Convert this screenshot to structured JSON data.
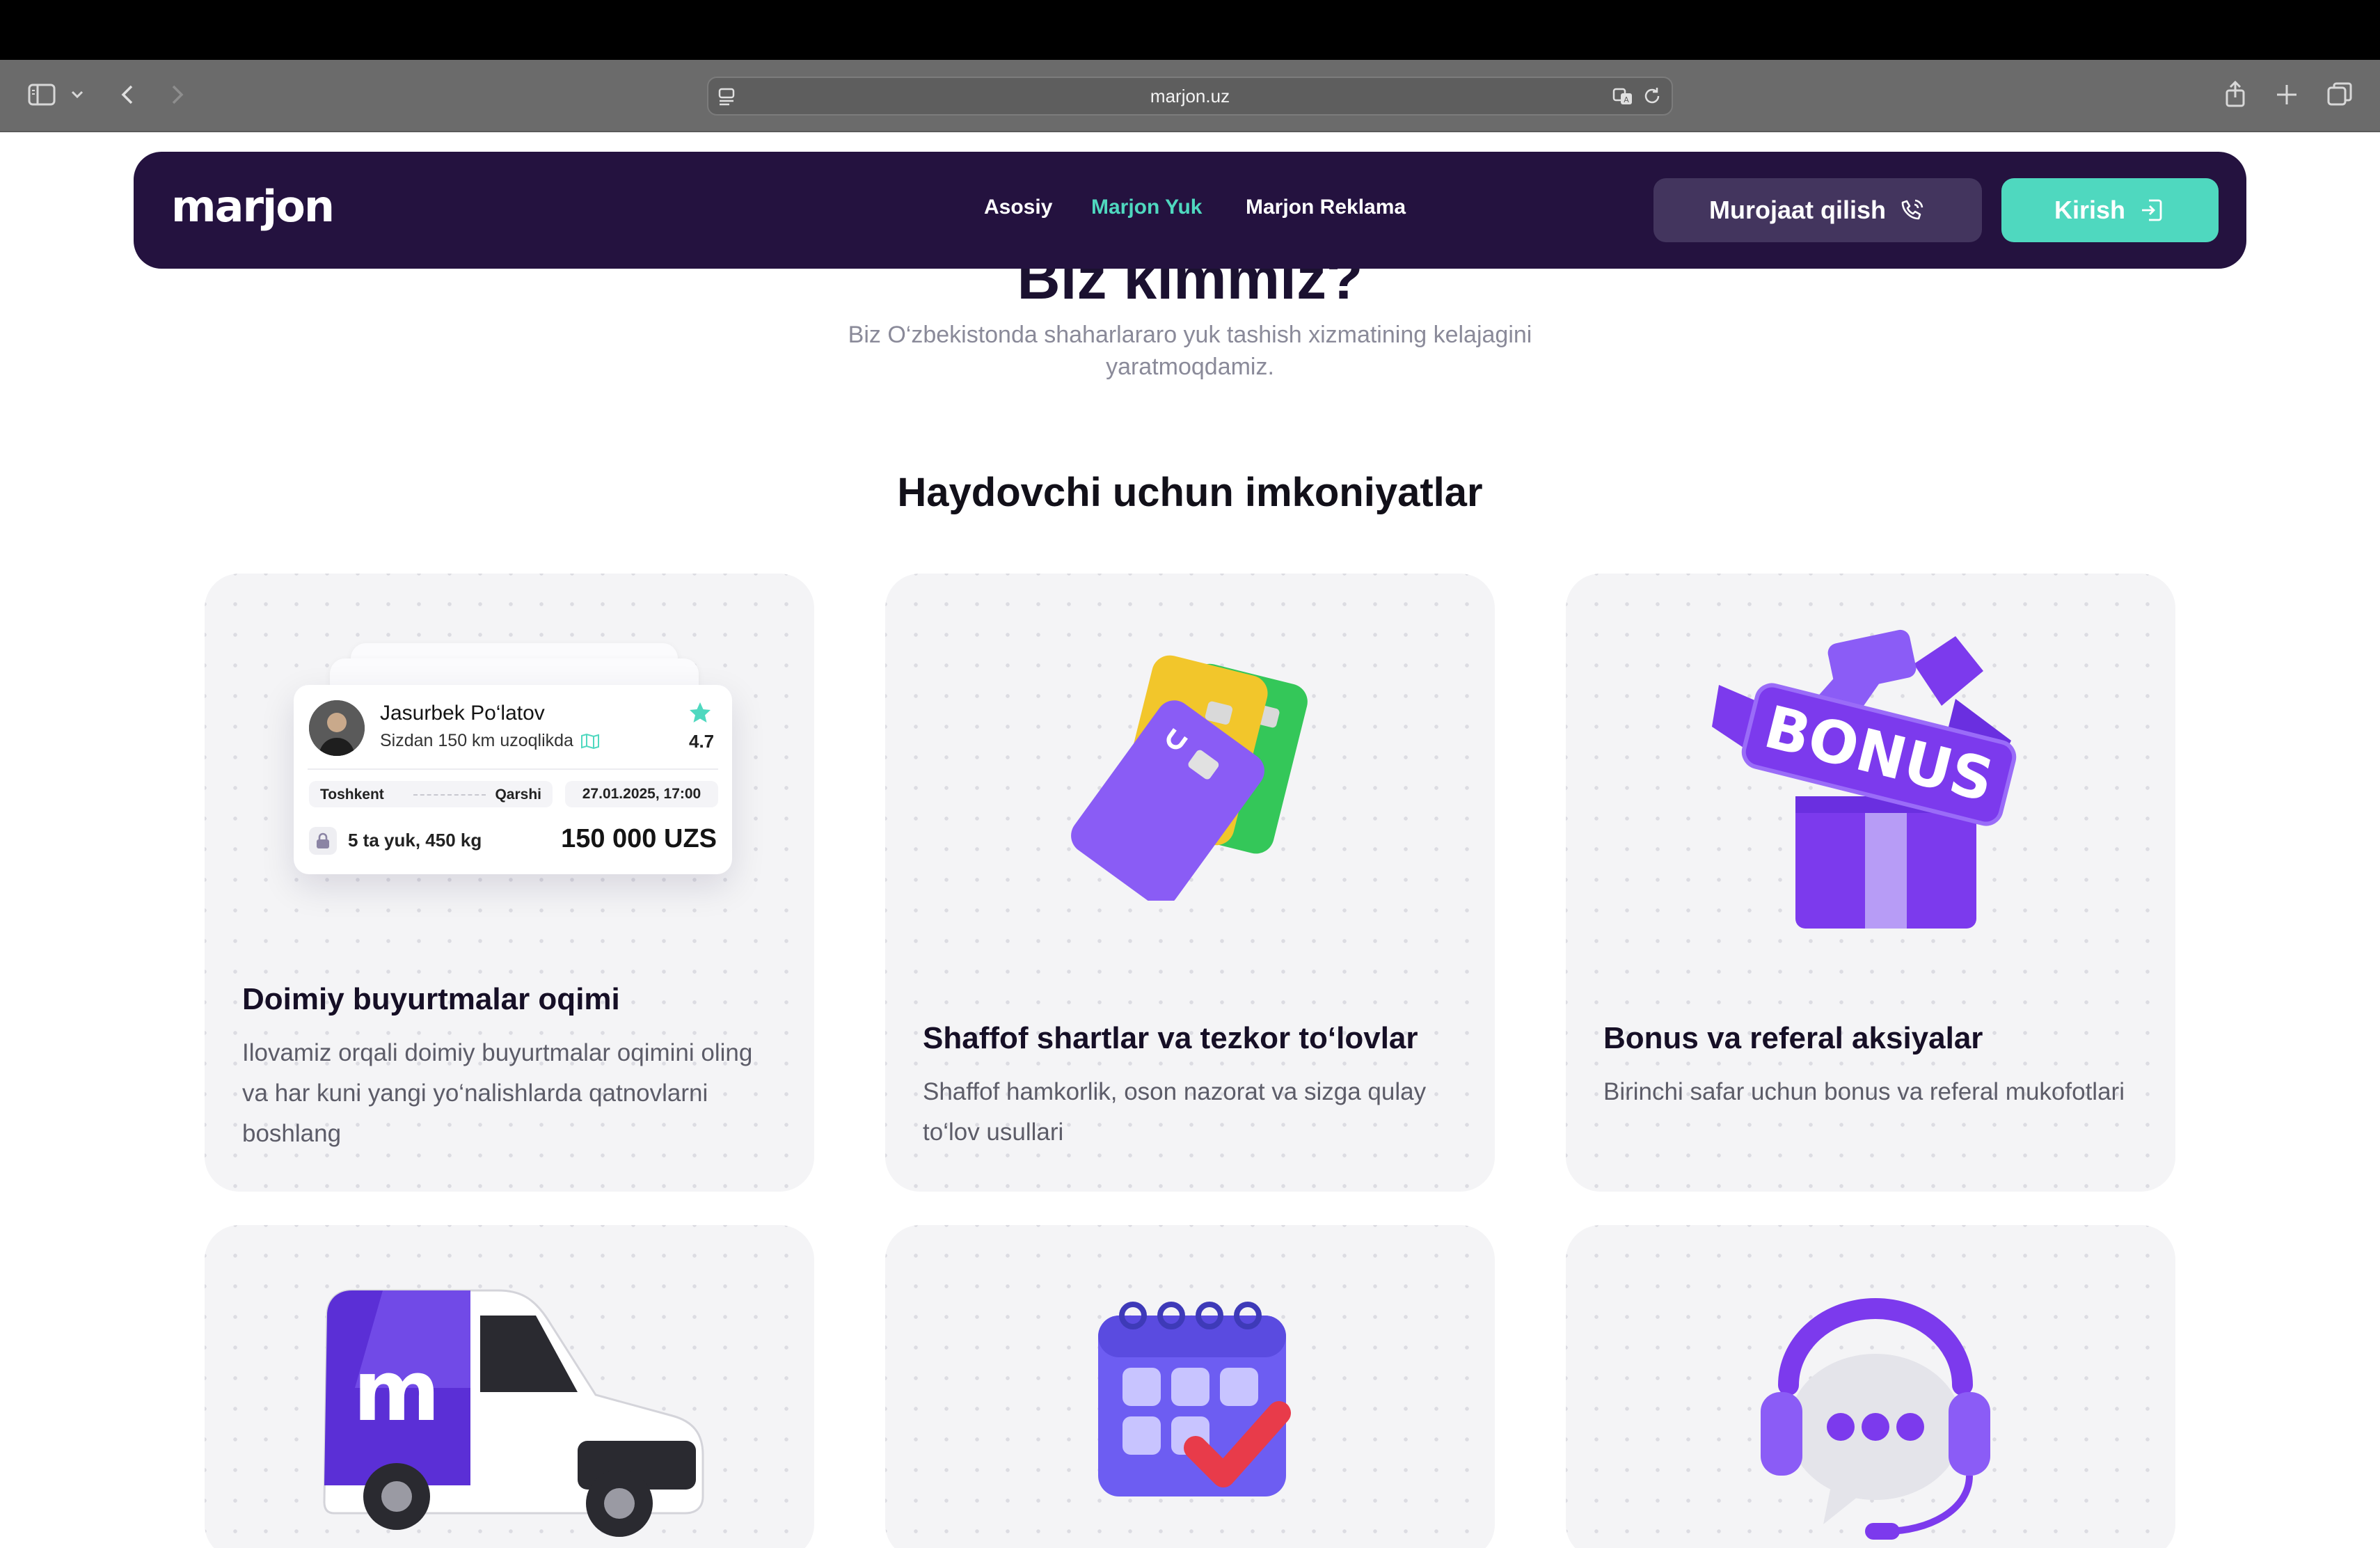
{
  "browser": {
    "url": "marjon.uz"
  },
  "header": {
    "logo": "marjon",
    "nav": [
      {
        "label": "Asosiy",
        "active": false
      },
      {
        "label": "Marjon Yuk",
        "active": true
      },
      {
        "label": "Marjon Reklama",
        "active": false
      }
    ],
    "contact_button": "Murojaat qilish",
    "login_button": "Kirish",
    "colors": {
      "header_bg": "#24123f",
      "accent": "#4fd8bf",
      "contact_bg": "#43355e"
    }
  },
  "about": {
    "heading": "Biz kimmiz?",
    "subtitle": "Biz O‘zbekistonda shaharlararo yuk tashish xizmatining kelajagini yaratmoqdamiz."
  },
  "features": {
    "title": "Haydovchi uchun imkoniyatlar",
    "cards": [
      {
        "title": "Doimiy buyurtmalar oqimi",
        "description": "Ilovamiz orqali doimiy buyurtmalar oqimini oling va har kuni yangi yo‘nalishlarda qatnovlarni boshlang",
        "icon": "order-card-illustration"
      },
      {
        "title": "Shaffof shartlar va tezkor to‘lovlar",
        "description": "Shaffof hamkorlik, oson nazorat va sizga qulay to‘lov usullari",
        "icon": "credit-cards-illustration"
      },
      {
        "title": "Bonus va referal aksiyalar",
        "description": "Birinchi safar uchun bonus va referal mukofotlari",
        "icon": "bonus-gift-illustration"
      },
      {
        "icon": "delivery-van-illustration"
      },
      {
        "icon": "calendar-illustration"
      },
      {
        "icon": "support-headset-illustration"
      }
    ]
  },
  "order_preview": {
    "driver_name": "Jasurbek Po‘latov",
    "distance": "Sizdan 150 km uzoqlikda",
    "rating": "4.7",
    "from": "Toshkent",
    "to": "Qarshi",
    "datetime": "27.01.2025, 17:00",
    "load": "5 ta yuk, 450 kg",
    "price": "150 000 UZS"
  },
  "bonus_label": "BONUS"
}
